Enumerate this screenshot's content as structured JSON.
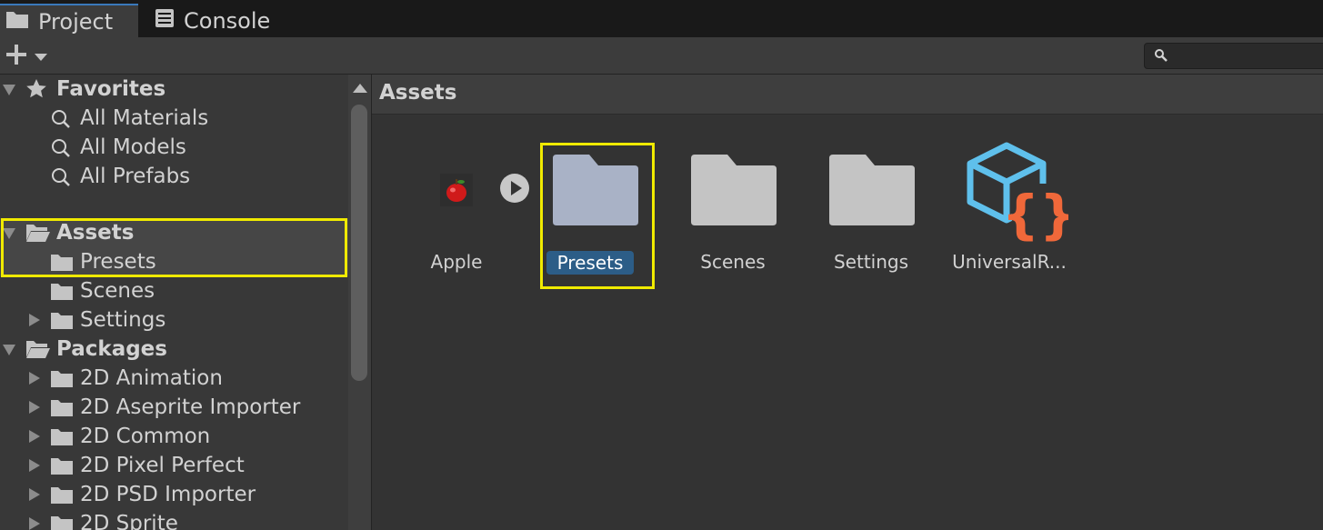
{
  "tabs": [
    {
      "label": "Project",
      "icon": "folder-icon",
      "active": true
    },
    {
      "label": "Console",
      "icon": "console-icon",
      "active": false
    }
  ],
  "toolbar": {
    "add_icon": "plus-icon",
    "search_placeholder": "",
    "search_value": ""
  },
  "tree": {
    "favorites": {
      "label": "Favorites",
      "items": [
        "All Materials",
        "All Models",
        "All Prefabs"
      ]
    },
    "assets": {
      "label": "Assets",
      "items": [
        {
          "label": "Presets",
          "selected": true,
          "expandable": false
        },
        {
          "label": "Scenes",
          "selected": false,
          "expandable": false
        },
        {
          "label": "Settings",
          "selected": false,
          "expandable": true
        }
      ]
    },
    "packages": {
      "label": "Packages",
      "items": [
        "2D Animation",
        "2D Aseprite Importer",
        "2D Common",
        "2D Pixel Perfect",
        "2D PSD Importer",
        "2D Sprite"
      ]
    }
  },
  "browser": {
    "breadcrumb": "Assets",
    "items": [
      {
        "name": "Apple",
        "kind": "sprite",
        "selected": false
      },
      {
        "name": "Presets",
        "kind": "folder",
        "selected": true
      },
      {
        "name": "Scenes",
        "kind": "folder",
        "selected": false
      },
      {
        "name": "Settings",
        "kind": "folder",
        "selected": false
      },
      {
        "name": "UniversalR...",
        "kind": "render-pipeline-asset",
        "selected": false
      }
    ]
  },
  "colors": {
    "selection": "#2c5d87",
    "highlight": "#f0ea00",
    "folder": "#c4c4c4",
    "folder_selected": "#a9b2c6",
    "urp_cube": "#5fc0ec",
    "urp_braces": "#f0683a"
  }
}
